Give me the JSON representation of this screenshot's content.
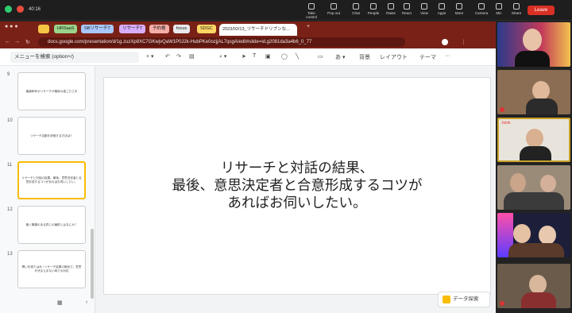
{
  "zoom": {
    "timer": "40:16",
    "buttons": [
      "Take control",
      "Pop out",
      "Chat",
      "People",
      "Raise",
      "React",
      "View",
      "Apps",
      "More",
      "Camera",
      "Mic",
      "Share"
    ],
    "leave": "Leave"
  },
  "browser": {
    "bookmarks": [
      "HRSaaS",
      "SBリサーチT",
      "リサーチT",
      "予約権",
      "focus",
      "SDGC"
    ],
    "tab_title": "2023/02/13_リサーチドリブンな…",
    "url": "docs.google.com/presentation/d/1g.zuzXp8XC7GKwjvQaW1P0J2k-HubPKe0ozjjAL7qsgA/edit#slide=id.g2081da3a4b6_0_77"
  },
  "toolbar": {
    "search_placeholder": "メニューを検索 (option+/)",
    "background": "背景",
    "layout": "レイアウト",
    "theme": "テーマ"
  },
  "slides": [
    {
      "num": "9",
      "text": "議論和年ボリサーチが最後の歯ごださま"
    },
    {
      "num": "10",
      "text": "リサーチ活動を評価する方法は？"
    },
    {
      "num": "11",
      "text": "リサーチと対話の結果、最後、意思決定者と合意形成するコツがあればお伺いしたい。"
    },
    {
      "num": "12",
      "text": "働く職場のある同じの最終とはなにか？"
    },
    {
      "num": "13",
      "text": "問いを修たはみ / リサーチ結果の無効で、意思が決まえまない時での対応"
    }
  ],
  "main_slide": {
    "lines": [
      "リサーチと対話の結果、",
      "最後、意思決定者と合意形成するコツが",
      "あればお伺いしたい。"
    ]
  },
  "explore": "データ探索",
  "participants": [
    {
      "label": ""
    },
    {
      "label": ""
    },
    {
      "label": "Joink"
    },
    {
      "label": ""
    },
    {
      "label": ""
    },
    {
      "label": ""
    }
  ]
}
